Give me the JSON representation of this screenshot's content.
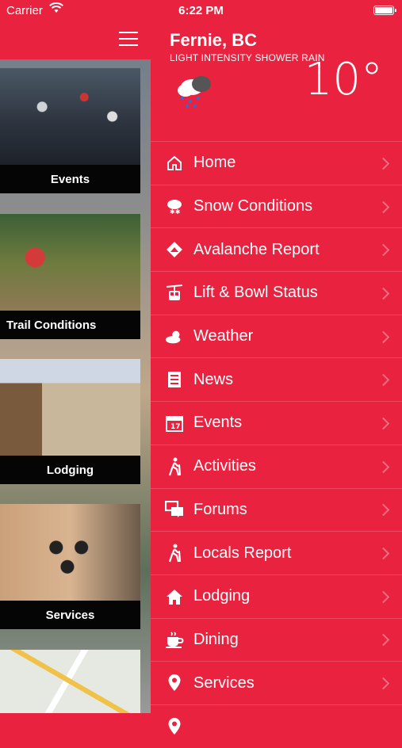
{
  "status": {
    "carrier": "Carrier",
    "time": "6:22 PM"
  },
  "weather": {
    "city": "Fernie, BC",
    "condition": "LIGHT INTENSITY SHOWER RAIN",
    "temperature": "10°",
    "icon": "rain-cloud-icon"
  },
  "tiles": [
    {
      "label": "Events"
    },
    {
      "label": "Trail Conditions"
    },
    {
      "label": "Lodging"
    },
    {
      "label": "Services"
    }
  ],
  "menu": [
    {
      "label": "Home",
      "icon": "home-icon"
    },
    {
      "label": "Snow Conditions",
      "icon": "snow-cloud-icon"
    },
    {
      "label": "Avalanche Report",
      "icon": "avalanche-icon"
    },
    {
      "label": "Lift & Bowl Status",
      "icon": "gondola-icon"
    },
    {
      "label": "Weather",
      "icon": "sun-cloud-icon"
    },
    {
      "label": "News",
      "icon": "news-icon"
    },
    {
      "label": "Events",
      "icon": "calendar-icon"
    },
    {
      "label": "Activities",
      "icon": "hiker-icon"
    },
    {
      "label": "Forums",
      "icon": "chat-icon"
    },
    {
      "label": "Locals Report",
      "icon": "hiker-icon"
    },
    {
      "label": "Lodging",
      "icon": "house-icon"
    },
    {
      "label": "Dining",
      "icon": "coffee-icon"
    },
    {
      "label": "Services",
      "icon": "location-pin-icon"
    }
  ],
  "colors": {
    "accent": "#e8223f",
    "text": "#ffffff"
  }
}
